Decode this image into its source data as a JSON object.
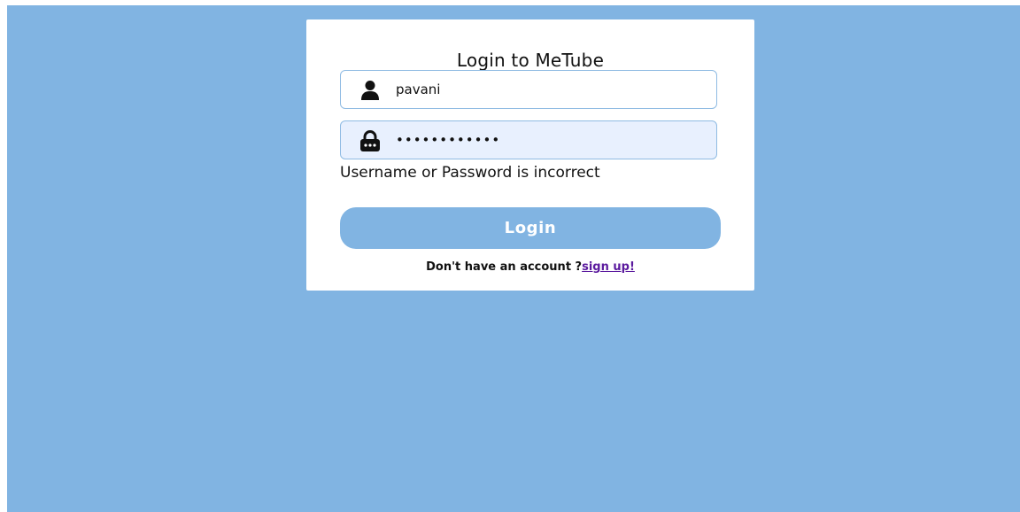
{
  "login": {
    "title": "Login to MeTube",
    "username": {
      "value": "pavani",
      "icon": "user-icon"
    },
    "password": {
      "value": "••••••••••••",
      "icon": "lock-icon"
    },
    "error_message": "Username or Password is incorrect",
    "login_button_label": "Login",
    "signup_prompt": "Don't have an account ?",
    "signup_link": "sign up!"
  },
  "colors": {
    "background": "#81b4e2",
    "button": "#81b4e2",
    "password_field_bg": "#e8f0fe",
    "field_border": "#8fbbe3",
    "link": "#5b1a9e"
  }
}
